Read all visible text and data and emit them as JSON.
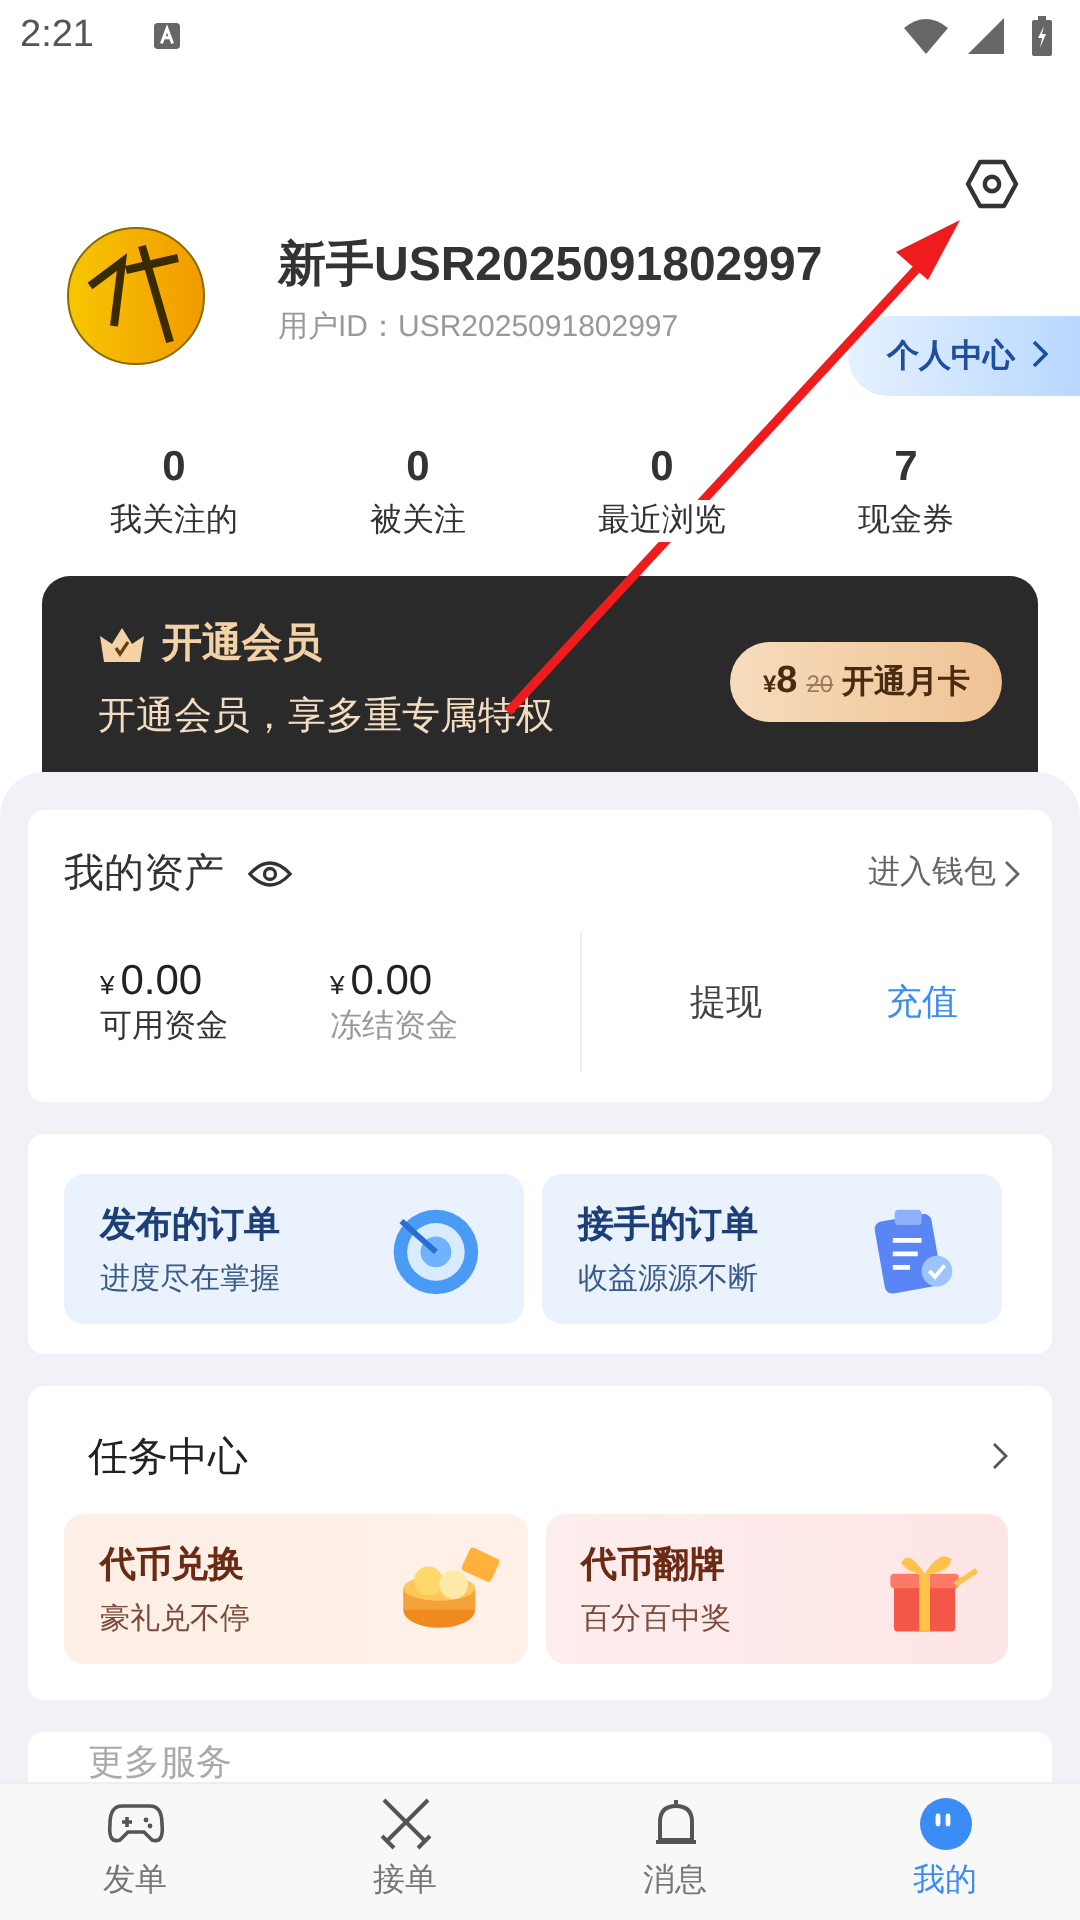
{
  "status_bar": {
    "time": "2:21"
  },
  "profile": {
    "name": "新手USR2025091802997",
    "user_id": "用户ID：USR2025091802997",
    "center_button": "个人中心"
  },
  "stats": [
    {
      "value": "0",
      "label": "我关注的"
    },
    {
      "value": "0",
      "label": "被关注"
    },
    {
      "value": "0",
      "label": "最近浏览"
    },
    {
      "value": "7",
      "label": "现金券"
    }
  ],
  "vip": {
    "title": "开通会员",
    "subtitle": "开通会员，享多重专属特权",
    "currency": "¥",
    "price": "8",
    "original_price": "20",
    "button_label": "开通月卡"
  },
  "assets": {
    "title": "我的资产",
    "wallet_link": "进入钱包",
    "balances": [
      {
        "currency": "¥",
        "amount": "0.00",
        "label": "可用资金"
      },
      {
        "currency": "¥",
        "amount": "0.00",
        "label": "冻结资金"
      }
    ],
    "actions": [
      {
        "label": "提现",
        "kind": "plain"
      },
      {
        "label": "充值",
        "kind": "primary"
      }
    ]
  },
  "orders": [
    {
      "title": "发布的订单",
      "subtitle": "进度尽在掌握",
      "kind": "target"
    },
    {
      "title": "接手的订单",
      "subtitle": "收益源源不断",
      "kind": "clipboard"
    }
  ],
  "tasks": {
    "title": "任务中心",
    "items": [
      {
        "title": "代币兑换",
        "subtitle": "豪礼兑不停",
        "kind": "coins"
      },
      {
        "title": "代币翻牌",
        "subtitle": "百分百中奖",
        "kind": "gift"
      }
    ]
  },
  "more_services": {
    "title": "更多服务"
  },
  "nav": [
    {
      "label": "发单",
      "kind": "gamepad",
      "selected": false
    },
    {
      "label": "接单",
      "kind": "swords",
      "selected": false
    },
    {
      "label": "消息",
      "kind": "bell",
      "selected": false
    },
    {
      "label": "我的",
      "kind": "face",
      "selected": true
    }
  ]
}
